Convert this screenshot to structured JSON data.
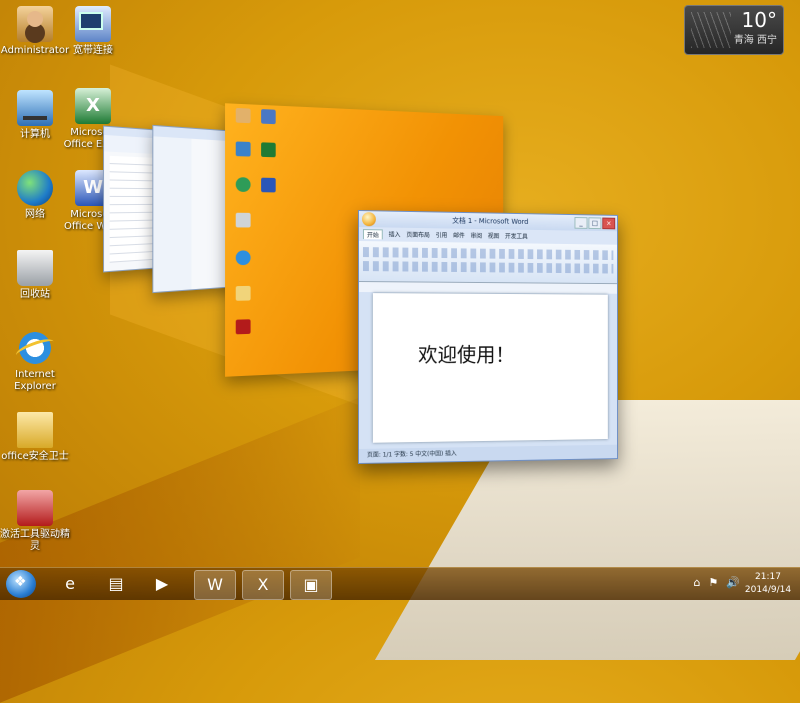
{
  "desktop": {
    "icons": [
      {
        "label": "Administrator",
        "icon": "user-folder-icon"
      },
      {
        "label": "宽带连接",
        "icon": "broadband-connection-icon"
      },
      {
        "label": "计算机",
        "icon": "computer-icon"
      },
      {
        "label": "Microsoft Office Excel",
        "icon": "excel-icon"
      },
      {
        "label": "网络",
        "icon": "network-icon"
      },
      {
        "label": "Microsoft Office Word",
        "icon": "word-icon"
      },
      {
        "label": "回收站",
        "icon": "recycle-bin-icon"
      },
      {
        "label": "Internet Explorer",
        "icon": "ie-icon"
      },
      {
        "label": "office安全卫士",
        "icon": "folder-icon"
      },
      {
        "label": "激活工具驱动精灵",
        "icon": "activation-tool-icon"
      }
    ]
  },
  "weather": {
    "temperature": "10°",
    "location": "青海 西宁"
  },
  "flip3d": {
    "word_window": {
      "title": "文档 1 - Microsoft Word",
      "tabs": [
        "开始",
        "插入",
        "页面布局",
        "引用",
        "邮件",
        "审阅",
        "视图",
        "开发工具"
      ],
      "active_tab": "开始",
      "document_text": "欢迎使用！",
      "status_text": "页面: 1/1  字数: 5  中文(中国)  插入"
    }
  },
  "taskbar": {
    "items": [
      "start-button",
      "ie-icon",
      "file-explorer-icon",
      "media-player-icon",
      "word-icon",
      "excel-icon",
      "remote-desktop-icon"
    ],
    "active_items": [
      "word-icon",
      "excel-icon"
    ],
    "time": "21:17",
    "date": "2014/9/14"
  }
}
